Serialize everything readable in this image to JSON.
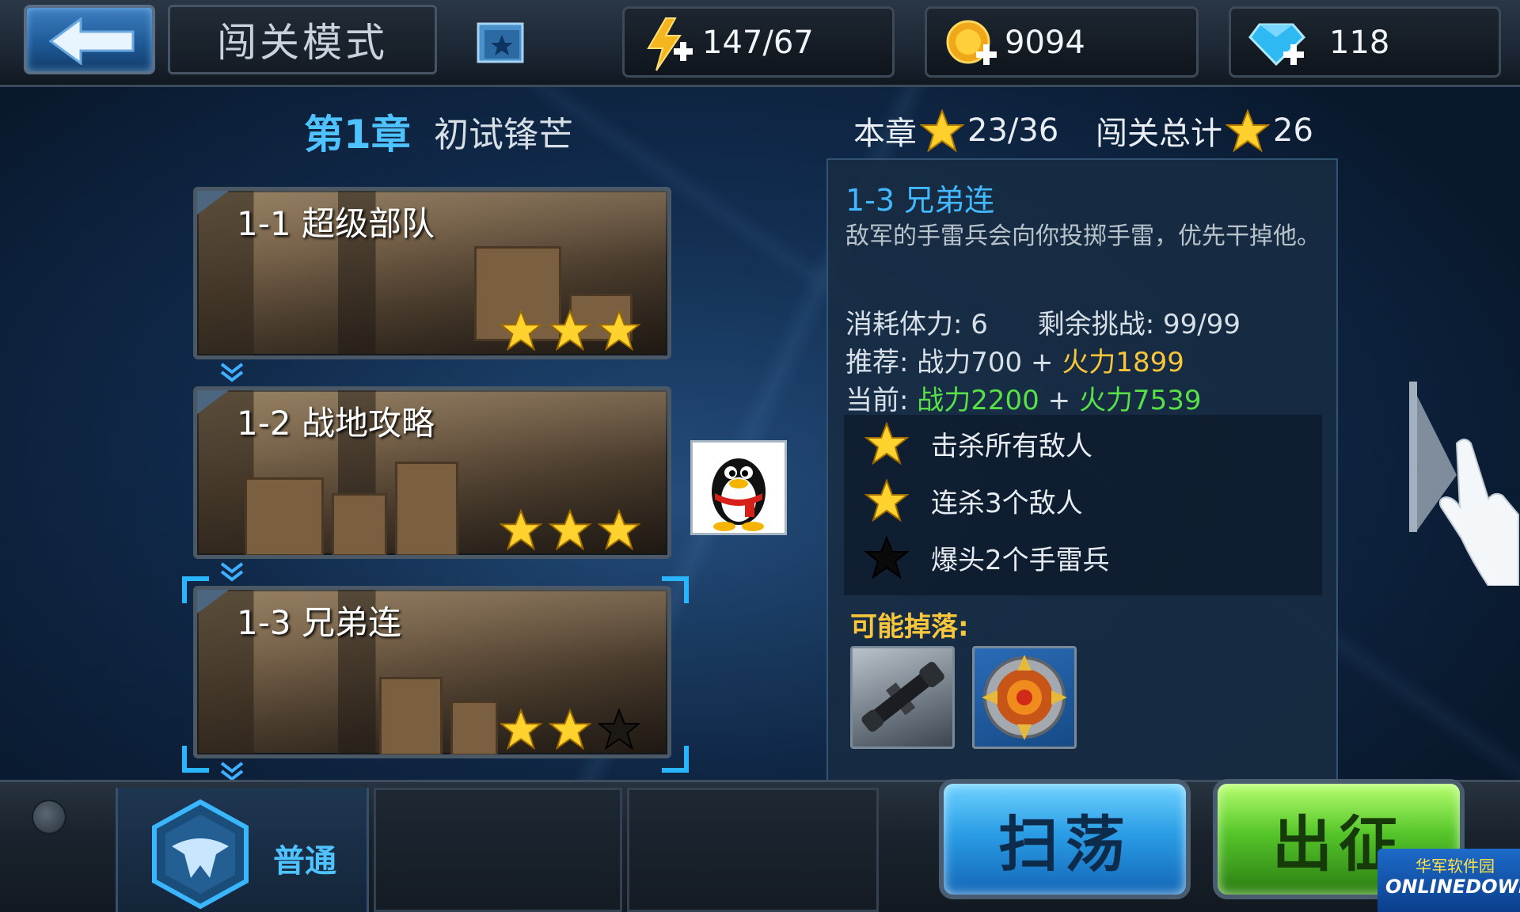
{
  "header": {
    "mode_title": "闯关模式",
    "energy": "147/67",
    "gold": "9094",
    "diamond": "118"
  },
  "chapter": {
    "title": "第1章",
    "subtitle": "初试锋芒",
    "chapter_stars_label": "本章",
    "chapter_stars": "23/36",
    "total_stars_label": "闯关总计",
    "total_stars": "26"
  },
  "levels": [
    {
      "label": "1-1 超级部队",
      "stars_earned": 3,
      "stars_total": 3
    },
    {
      "label": "1-2 战地攻略",
      "stars_earned": 3,
      "stars_total": 3
    },
    {
      "label": "1-3 兄弟连",
      "stars_earned": 2,
      "stars_total": 3
    }
  ],
  "detail": {
    "title": "1-3 兄弟连",
    "description": "敌军的手雷兵会向你投掷手雷，优先干掉他。",
    "stamina_label": "消耗体力:",
    "stamina_value": "6",
    "remaining_label": "剩余挑战:",
    "remaining_value": "99/99",
    "recommend_label": "推荐:",
    "recommend_power": "战力700",
    "recommend_plus": "+",
    "recommend_fire": "火力1899",
    "current_label": "当前:",
    "current_power": "战力2200",
    "current_plus": "+",
    "current_fire": "火力7539",
    "conditions": [
      {
        "text": "击杀所有敌人",
        "achieved": true
      },
      {
        "text": "连杀3个敌人",
        "achieved": true
      },
      {
        "text": "爆头2个手雷兵",
        "achieved": false
      }
    ],
    "drops_label": "可能掉落:",
    "drops": [
      "scope-icon",
      "badge-icon"
    ]
  },
  "bottom": {
    "difficulty": "普通",
    "sweep_button": "扫荡",
    "attack_button": "出征"
  },
  "watermark": {
    "cn": "华军软件园",
    "en": "ONLINEDOWN"
  },
  "colors": {
    "accent_blue": "#41b8ff",
    "gold": "#f7c63a",
    "green": "#58e047"
  }
}
